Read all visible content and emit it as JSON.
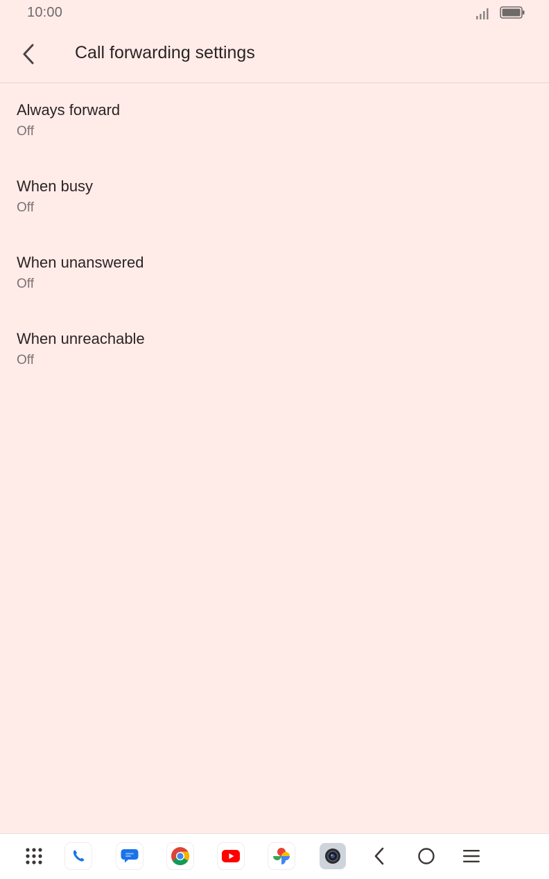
{
  "status_bar": {
    "time": "10:00"
  },
  "app_bar": {
    "title": "Call forwarding settings",
    "back_icon": "chevron-left-icon"
  },
  "settings": [
    {
      "title": "Always forward",
      "summary": "Off"
    },
    {
      "title": "When busy",
      "summary": "Off"
    },
    {
      "title": "When unanswered",
      "summary": "Off"
    },
    {
      "title": "When unreachable",
      "summary": "Off"
    }
  ],
  "nav_bar": {
    "items": [
      "app-drawer-icon",
      "phone-app-icon",
      "messages-app-icon",
      "chrome-app-icon",
      "youtube-app-icon",
      "photos-app-icon",
      "camera-app-icon",
      "back-nav-icon",
      "home-nav-icon",
      "recents-nav-icon"
    ]
  },
  "colors": {
    "background": "#FFECE9",
    "title_text": "#2b2322",
    "summary_text": "#7b7371",
    "divider": "#e3d6d3",
    "nav_background": "#ffffff"
  }
}
